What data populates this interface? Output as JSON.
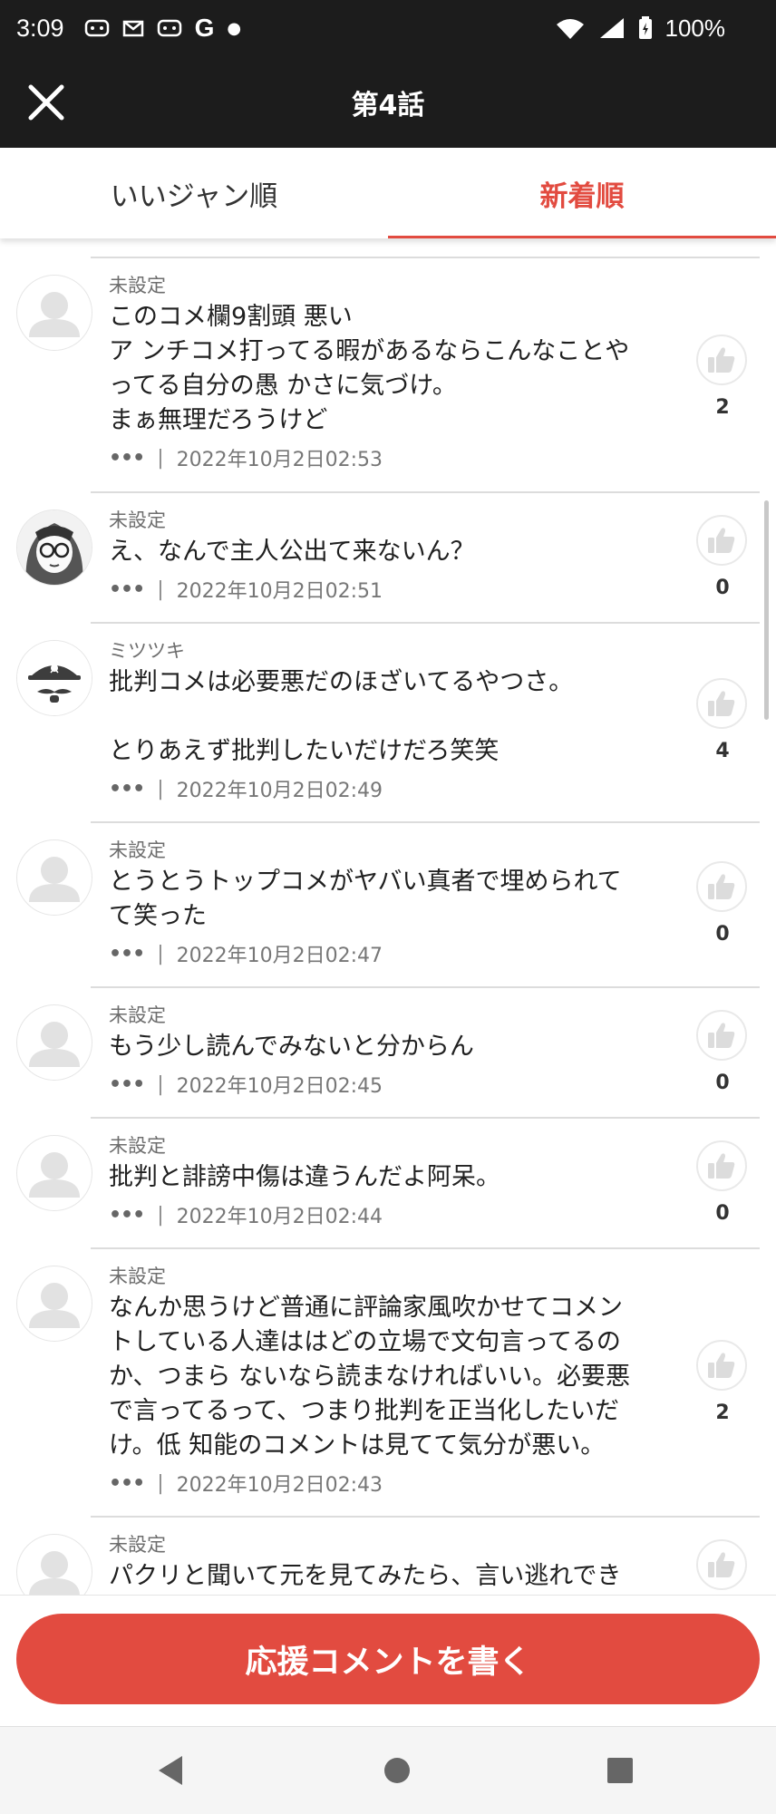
{
  "status_bar": {
    "time": "3:09",
    "battery": "100%",
    "notification_icons": [
      "game-icon",
      "mail-icon",
      "game-icon",
      "google-icon",
      "dot-icon"
    ]
  },
  "appbar": {
    "title": "第4話"
  },
  "tabs": [
    {
      "label": "いいジャン順",
      "active": false
    },
    {
      "label": "新着順",
      "active": true
    }
  ],
  "comments": [
    {
      "user": "未設定",
      "text": "このコメ欄9割頭 悪い\nア ンチコメ打ってる暇があるならこんなことや\nってる自分の愚 かさに気づけ。\nまぁ無理だろうけど",
      "more": "•••",
      "separator": "|",
      "date": "2022年10月2日02:53",
      "likes": "2",
      "avatar": "default"
    },
    {
      "user": "未設定",
      "text": "え、なんで主人公出て来ないん？",
      "more": "•••",
      "separator": "|",
      "date": "2022年10月2日02:51",
      "likes": "0",
      "avatar": "manga"
    },
    {
      "user": "ミツツキ",
      "text": "批判コメは必要悪だのほざいてるやつさ。\n\nとりあえず批判したいだけだろ笑笑",
      "more": "•••",
      "separator": "|",
      "date": "2022年10月2日02:49",
      "likes": "4",
      "avatar": "pirate"
    },
    {
      "user": "未設定",
      "text": "とうとうトップコメがヤバい真者で埋められて\nて笑った",
      "more": "•••",
      "separator": "|",
      "date": "2022年10月2日02:47",
      "likes": "0",
      "avatar": "default"
    },
    {
      "user": "未設定",
      "text": "もう少し読んでみないと分からん",
      "more": "•••",
      "separator": "|",
      "date": "2022年10月2日02:45",
      "likes": "0",
      "avatar": "default"
    },
    {
      "user": "未設定",
      "text": "批判と誹謗中傷は違うんだよ阿呆。",
      "more": "•••",
      "separator": "|",
      "date": "2022年10月2日02:44",
      "likes": "0",
      "avatar": "default"
    },
    {
      "user": "未設定",
      "text": "なんか思うけど普通に評論家風吹かせてコメン\nトしている人達ははどの立場で文句言ってるの\nか、つまら ないなら読まなければいい。必要悪\nで言ってるって、つまり批判を正当化したいだ\nけ。低 知能のコメントは見てて気分が悪い。",
      "more": "•••",
      "separator": "|",
      "date": "2022年10月2日02:43",
      "likes": "2",
      "avatar": "default"
    },
    {
      "user": "未設定",
      "text": "パクリと聞いて元を見てみたら、言い逃れでき",
      "more": "",
      "separator": "",
      "date": "",
      "likes": "",
      "avatar": "default"
    }
  ],
  "write_button": {
    "label": "応援コメントを書く"
  },
  "colors": {
    "accent": "#e24b40",
    "header_bg": "#1c1c1c"
  }
}
